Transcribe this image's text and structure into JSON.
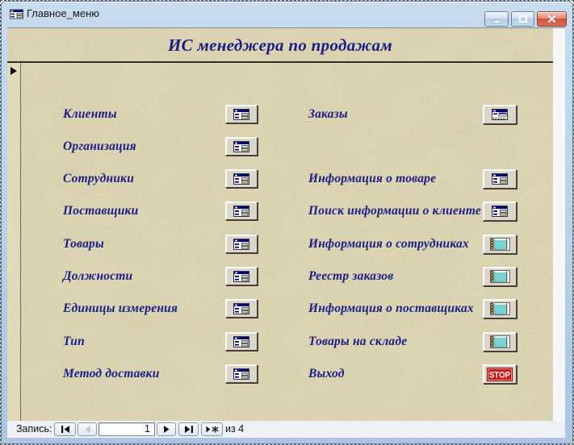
{
  "window": {
    "title": "Главное_меню",
    "icon": "access-form-icon",
    "controls": [
      {
        "name": "minimize"
      },
      {
        "name": "restore"
      },
      {
        "name": "close"
      }
    ]
  },
  "form": {
    "header_title": "ИС менеджера по продажам",
    "record_selector_icon": "current-record-arrow",
    "stop_icon_text": "STOP",
    "menu_left": [
      {
        "label": "Клиенты",
        "icon": "form-icon"
      },
      {
        "label": "Организация",
        "icon": "form-icon"
      },
      {
        "label": "Сотрудники",
        "icon": "form-icon"
      },
      {
        "label": "Поставщики",
        "icon": "form-icon"
      },
      {
        "label": "Товары",
        "icon": "form-icon"
      },
      {
        "label": "Должности",
        "icon": "form-icon"
      },
      {
        "label": "Единицы измерения",
        "icon": "form-icon"
      },
      {
        "label": "Тип",
        "icon": "form-icon"
      },
      {
        "label": "Метод доставки",
        "icon": "form-icon"
      }
    ],
    "menu_right": [
      {
        "label": "Заказы",
        "icon": "form-subform-icon"
      },
      {
        "label": "Информация о товаре",
        "icon": "form-icon"
      },
      {
        "label": "Поиск информации о клиенте",
        "icon": "form-icon"
      },
      {
        "label": "Информация о сотрудниках",
        "icon": "report-icon"
      },
      {
        "label": "Реестр заказов",
        "icon": "report-icon"
      },
      {
        "label": "Информация о поставщиках",
        "icon": "report-icon"
      },
      {
        "label": "Товары на складе",
        "icon": "report-icon"
      },
      {
        "label": "Выход",
        "icon": "stop-icon"
      }
    ]
  },
  "navigation": {
    "record_label": "Запись:",
    "current_record": "1",
    "total_text": "из 4",
    "buttons": [
      {
        "name": "first-record",
        "disabled": false
      },
      {
        "name": "previous-record",
        "disabled": true
      },
      {
        "name": "next-record",
        "disabled": false
      },
      {
        "name": "last-record",
        "disabled": false
      },
      {
        "name": "new-record",
        "disabled": false
      }
    ]
  },
  "colors": {
    "label_navy": "#1c1c86",
    "form_background_tan": "#e5debc",
    "titlebar_blue": "#bcd3e9",
    "stop_red": "#d01818",
    "report_teal": "#49bfbf",
    "button_face": "#dbd6c9"
  }
}
